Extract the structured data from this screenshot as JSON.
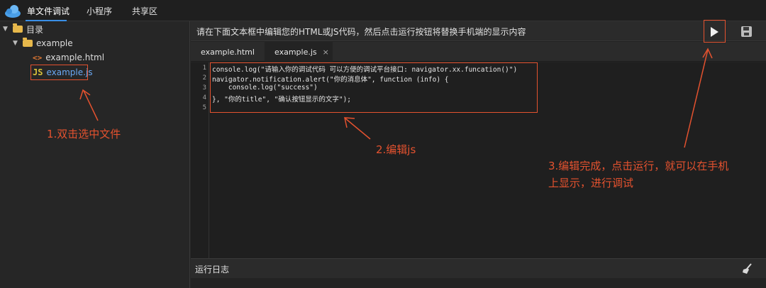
{
  "topbar": {
    "tabs": [
      "单文件调试",
      "小程序",
      "共享区"
    ]
  },
  "tree": {
    "root": "目录",
    "folder": "example",
    "files": [
      "example.html",
      "example.js"
    ],
    "icons": {
      "html": "<>",
      "js": "JS"
    }
  },
  "editor": {
    "instruction": "请在下面文本框中编辑您的HTML或JS代码，然后点击运行按钮将替换手机端的显示内容",
    "tabs": [
      {
        "label": "example.html"
      },
      {
        "label": "example.js",
        "close": "×"
      }
    ],
    "lines": [
      {
        "no": "1",
        "text": "console.log(\"请输入你的调试代码 可以方便的调试平台接口: navigator.xx.funcation()\")"
      },
      {
        "no": "2",
        "text": "navigator.notification.alert(\"你的消息体\", function (info) {"
      },
      {
        "no": "3",
        "text": "    console.log(\"success\")"
      },
      {
        "no": "4",
        "text": "}, \"你的title\", \"确认按钮显示的文字\");"
      },
      {
        "no": "5",
        "text": ""
      }
    ]
  },
  "log": {
    "title": "运行日志"
  },
  "annotations": {
    "step1": "1.双击选中文件",
    "step2": "2.编辑js",
    "step3_line1": "3.编辑完成，点击运行，就可以在手机",
    "step3_line2": "上显示，进行调试",
    "color": "#e4522f"
  }
}
